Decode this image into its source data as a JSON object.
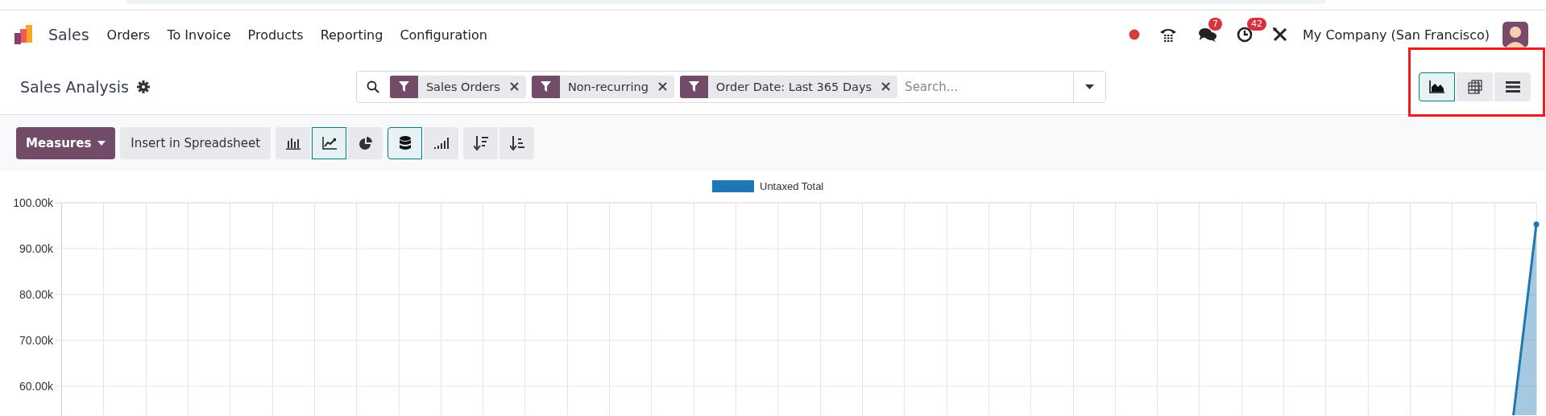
{
  "app": {
    "name": "Sales"
  },
  "menu": [
    {
      "label": "Orders"
    },
    {
      "label": "To Invoice"
    },
    {
      "label": "Products"
    },
    {
      "label": "Reporting"
    },
    {
      "label": "Configuration"
    }
  ],
  "systray": {
    "chat_count": "7",
    "activity_count": "42",
    "company": "My Company (San Francisco)"
  },
  "breadcrumb": {
    "title": "Sales Analysis"
  },
  "search": {
    "facets": [
      {
        "label": "Sales Orders"
      },
      {
        "label": "Non-recurring"
      },
      {
        "label": "Order Date: Last 365 Days"
      }
    ],
    "placeholder": "Search..."
  },
  "views": [
    {
      "kind": "graph",
      "selected": true
    },
    {
      "kind": "pivot",
      "selected": false
    },
    {
      "kind": "list",
      "selected": false
    }
  ],
  "toolbar": {
    "measures": "Measures",
    "insert": "Insert in Spreadsheet",
    "chart_types": [
      {
        "kind": "bar",
        "selected": false
      },
      {
        "kind": "line",
        "selected": true
      },
      {
        "kind": "pie",
        "selected": false
      }
    ],
    "options": [
      {
        "kind": "stacked",
        "selected": true
      },
      {
        "kind": "cumulative",
        "selected": false
      }
    ],
    "sorts": [
      {
        "kind": "descending"
      },
      {
        "kind": "ascending"
      }
    ]
  },
  "chart": {
    "chart_data": {
      "type": "area",
      "grid": true,
      "ylim": [
        0,
        100000
      ],
      "yticks": [
        {
          "value": 60000,
          "label": "60.00k"
        },
        {
          "value": 70000,
          "label": "70.00k"
        },
        {
          "value": 80000,
          "label": "80.00k"
        },
        {
          "value": 90000,
          "label": "90.00k"
        },
        {
          "value": 100000,
          "label": "100.00k"
        }
      ],
      "series": [
        {
          "name": "Untaxed Total",
          "color": "#1f77b4",
          "values": [
            0,
            0,
            0,
            0,
            0,
            0,
            0,
            0,
            0,
            0,
            0,
            0,
            0,
            0,
            0,
            0,
            0,
            0,
            0,
            0,
            0,
            0,
            0,
            0,
            0,
            0,
            0,
            0,
            0,
            0,
            0,
            0,
            0,
            0,
            18800,
            95300
          ]
        }
      ]
    }
  }
}
